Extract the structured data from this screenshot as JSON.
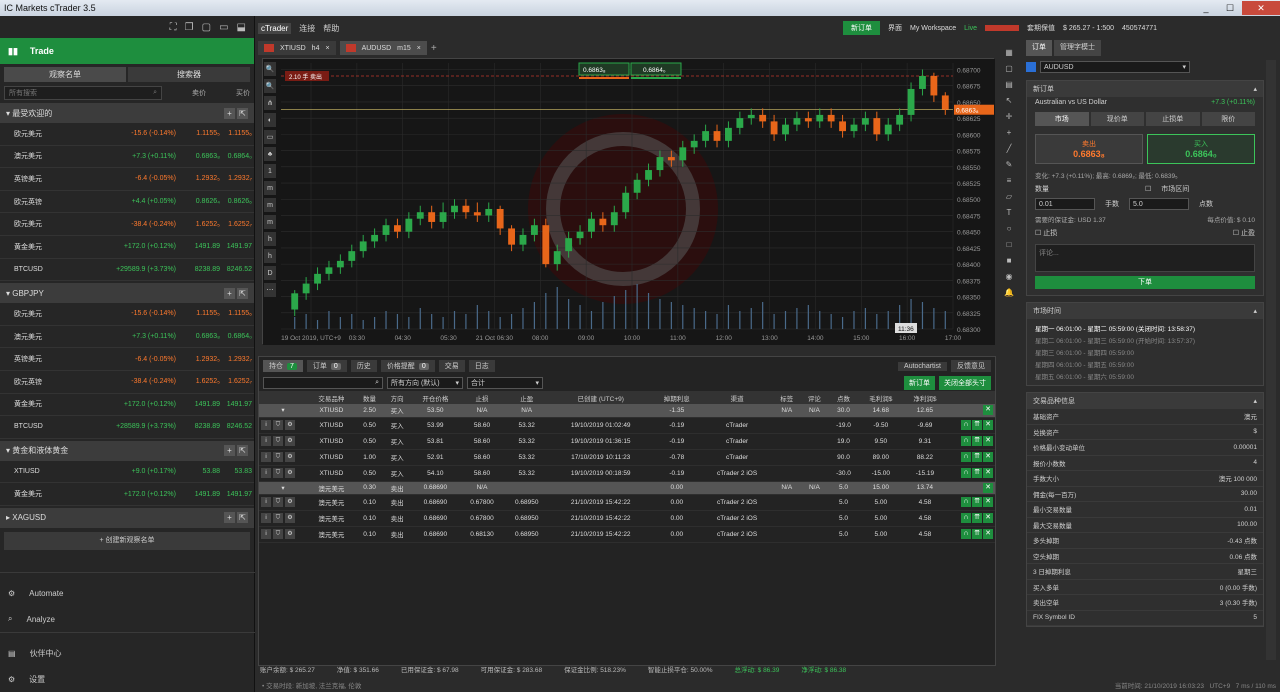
{
  "window": {
    "title": "IC Markets cTrader 3.5",
    "minimize": "_",
    "maximize": "☐",
    "close": "✕"
  },
  "left": {
    "top_icons": [
      "⛶",
      "❐",
      "▢",
      "▭",
      "⬓"
    ],
    "trade_label": "Trade",
    "tabs": [
      "观察名单",
      "搜索器"
    ],
    "search_placeholder": "所有搜索",
    "col_bid": "卖价",
    "col_ask": "买价",
    "groups": [
      {
        "name": "最受欢迎的",
        "collapsed": false,
        "rows": [
          {
            "sym": "欧元美元",
            "chg": "-15.6 (-0.14%)",
            "bid": "1.1155₅",
            "ask": "1.1155₆",
            "up": false
          },
          {
            "sym": "澳元美元",
            "chg": "+7.3 (+0.11%)",
            "bid": "0.6863₈",
            "ask": "0.6864₀",
            "up": true
          },
          {
            "sym": "英镑美元",
            "chg": "-6.4 (-0.05%)",
            "bid": "1.2932₅",
            "ask": "1.2932₇",
            "up": false
          },
          {
            "sym": "欧元英镑",
            "chg": "+4.4 (+0.05%)",
            "bid": "0.8626₄",
            "ask": "0.8626₆",
            "up": true
          },
          {
            "sym": "欧元美元",
            "chg": "-38.4 (-0.24%)",
            "bid": "1.6252₅",
            "ask": "1.6252₇",
            "up": false
          },
          {
            "sym": "黄金美元",
            "chg": "+172.0 (+0.12%)",
            "bid": "1491.89",
            "ask": "1491.97",
            "up": true
          },
          {
            "sym": "BTCUSD",
            "chg": "+29589.9 (+3.73%)",
            "bid": "8238.89",
            "ask": "8246.52",
            "up": true
          }
        ]
      },
      {
        "name": "GBPJPY",
        "collapsed": false,
        "rows": [
          {
            "sym": "欧元美元",
            "chg": "-15.6 (-0.14%)",
            "bid": "1.1155₅",
            "ask": "1.1155₆",
            "up": false
          },
          {
            "sym": "澳元美元",
            "chg": "+7.3 (+0.11%)",
            "bid": "0.6863₈",
            "ask": "0.6864₀",
            "up": true
          },
          {
            "sym": "英镑美元",
            "chg": "-6.4 (-0.05%)",
            "bid": "1.2932₅",
            "ask": "1.2932₇",
            "up": false
          },
          {
            "sym": "欧元英镑",
            "chg": "-38.4 (-0.24%)",
            "bid": "1.6252₅",
            "ask": "1.6252₇",
            "up": false
          },
          {
            "sym": "黄金美元",
            "chg": "+172.0 (+0.12%)",
            "bid": "1491.89",
            "ask": "1491.97",
            "up": true
          },
          {
            "sym": "BTCUSD",
            "chg": "+28589.9 (+3.73%)",
            "bid": "8238.89",
            "ask": "8246.52",
            "up": true
          }
        ]
      },
      {
        "name": "黄金和液体黄金",
        "collapsed": false,
        "rows": [
          {
            "sym": "XTIUSD",
            "chg": "+9.0 (+0.17%)",
            "bid": "53.88",
            "ask": "53.83",
            "up": true
          },
          {
            "sym": "黄金美元",
            "chg": "+172.0 (+0.12%)",
            "bid": "1491.89",
            "ask": "1491.97",
            "up": true
          }
        ]
      },
      {
        "name": "XAGUSD",
        "collapsed": true,
        "rows": []
      }
    ],
    "create_watchlist": "+ 创建新观察名单",
    "nav": [
      "Automate",
      "Analyze",
      "伙伴中心",
      "设置"
    ]
  },
  "menu": {
    "items": [
      "cTrader",
      "连接",
      "帮助"
    ]
  },
  "topright": {
    "new_order": "新订单",
    "interface": "界面",
    "workspace": "My Workspace",
    "live": "Live",
    "account_label": "套期保值",
    "balance": "$ 265.27 - 1:500",
    "account_id": "450574771"
  },
  "chart_tabs": [
    {
      "symbol": "XTIUSD",
      "tf": "h4",
      "active": false
    },
    {
      "symbol": "AUDUSD",
      "tf": "m15",
      "active": true
    }
  ],
  "chart": {
    "sell_price": "0.6863₈",
    "buy_price": "0.6864₀",
    "hline_label": "2.10 手 卖出",
    "current_price": "0.6863₈",
    "price_ticks": [
      "0.68700",
      "0.68675",
      "0.68650",
      "0.68625",
      "0.68600",
      "0.68575",
      "0.68550",
      "0.68525",
      "0.68500",
      "0.68475",
      "0.68450",
      "0.68425",
      "0.68400",
      "0.68375",
      "0.68350",
      "0.68325",
      "0.68300"
    ],
    "time_ticks": [
      "19 Oct 2019, UTC+9",
      "03:30",
      "04:30",
      "05:30",
      "21 Oct 06:30",
      "08:00",
      "09:00",
      "10:00",
      "11:00",
      "12:00",
      "13:00",
      "14:00",
      "15:00",
      "16:00",
      "17:00"
    ],
    "countdown": "11:36",
    "left_tools": [
      "🔍",
      "🔍",
      "⋔",
      "◐",
      "▭",
      "♣",
      "1",
      "m",
      "m",
      "m",
      "h",
      "h",
      "D",
      "⋯"
    ],
    "candles": [
      {
        "o": 0.6833,
        "c": 0.68355,
        "h": 0.6836,
        "l": 0.6832
      },
      {
        "o": 0.68355,
        "c": 0.6837,
        "h": 0.6838,
        "l": 0.68345
      },
      {
        "o": 0.6837,
        "c": 0.68385,
        "h": 0.68395,
        "l": 0.6836
      },
      {
        "o": 0.68385,
        "c": 0.68395,
        "h": 0.68405,
        "l": 0.68375
      },
      {
        "o": 0.68395,
        "c": 0.68405,
        "h": 0.68415,
        "l": 0.68385
      },
      {
        "o": 0.68405,
        "c": 0.6842,
        "h": 0.6843,
        "l": 0.68395
      },
      {
        "o": 0.6842,
        "c": 0.68435,
        "h": 0.68445,
        "l": 0.6841
      },
      {
        "o": 0.68435,
        "c": 0.68445,
        "h": 0.68455,
        "l": 0.68425
      },
      {
        "o": 0.68445,
        "c": 0.6846,
        "h": 0.6847,
        "l": 0.68435
      },
      {
        "o": 0.6846,
        "c": 0.6845,
        "h": 0.6847,
        "l": 0.6844
      },
      {
        "o": 0.6845,
        "c": 0.6847,
        "h": 0.6848,
        "l": 0.6844
      },
      {
        "o": 0.6847,
        "c": 0.6848,
        "h": 0.6849,
        "l": 0.6846
      },
      {
        "o": 0.6848,
        "c": 0.68465,
        "h": 0.6849,
        "l": 0.68455
      },
      {
        "o": 0.68465,
        "c": 0.6848,
        "h": 0.68495,
        "l": 0.68455
      },
      {
        "o": 0.6848,
        "c": 0.6849,
        "h": 0.685,
        "l": 0.6847
      },
      {
        "o": 0.6849,
        "c": 0.6848,
        "h": 0.685,
        "l": 0.6847
      },
      {
        "o": 0.6848,
        "c": 0.68475,
        "h": 0.68495,
        "l": 0.68465
      },
      {
        "o": 0.68475,
        "c": 0.68485,
        "h": 0.68495,
        "l": 0.68465
      },
      {
        "o": 0.68485,
        "c": 0.68455,
        "h": 0.6849,
        "l": 0.68445
      },
      {
        "o": 0.68455,
        "c": 0.6843,
        "h": 0.6846,
        "l": 0.6842
      },
      {
        "o": 0.6843,
        "c": 0.68445,
        "h": 0.68455,
        "l": 0.6842
      },
      {
        "o": 0.68445,
        "c": 0.6846,
        "h": 0.6847,
        "l": 0.68435
      },
      {
        "o": 0.6846,
        "c": 0.684,
        "h": 0.6847,
        "l": 0.68395
      },
      {
        "o": 0.684,
        "c": 0.6842,
        "h": 0.6843,
        "l": 0.6839
      },
      {
        "o": 0.6842,
        "c": 0.6844,
        "h": 0.6845,
        "l": 0.6841
      },
      {
        "o": 0.6844,
        "c": 0.6845,
        "h": 0.6846,
        "l": 0.6843
      },
      {
        "o": 0.6845,
        "c": 0.6847,
        "h": 0.6848,
        "l": 0.6844
      },
      {
        "o": 0.6847,
        "c": 0.6846,
        "h": 0.6848,
        "l": 0.6845
      },
      {
        "o": 0.6846,
        "c": 0.6848,
        "h": 0.6849,
        "l": 0.6845
      },
      {
        "o": 0.6848,
        "c": 0.6851,
        "h": 0.6852,
        "l": 0.6847
      },
      {
        "o": 0.6851,
        "c": 0.6853,
        "h": 0.6854,
        "l": 0.685
      },
      {
        "o": 0.6853,
        "c": 0.68545,
        "h": 0.68555,
        "l": 0.6852
      },
      {
        "o": 0.68545,
        "c": 0.68565,
        "h": 0.68575,
        "l": 0.68535
      },
      {
        "o": 0.68565,
        "c": 0.6856,
        "h": 0.68575,
        "l": 0.6855
      },
      {
        "o": 0.6856,
        "c": 0.6858,
        "h": 0.6859,
        "l": 0.6855
      },
      {
        "o": 0.6858,
        "c": 0.6859,
        "h": 0.686,
        "l": 0.6857
      },
      {
        "o": 0.6859,
        "c": 0.68605,
        "h": 0.68615,
        "l": 0.6858
      },
      {
        "o": 0.68605,
        "c": 0.6859,
        "h": 0.68615,
        "l": 0.6858
      },
      {
        "o": 0.6859,
        "c": 0.6861,
        "h": 0.6862,
        "l": 0.6858
      },
      {
        "o": 0.6861,
        "c": 0.68625,
        "h": 0.68635,
        "l": 0.686
      },
      {
        "o": 0.68625,
        "c": 0.6863,
        "h": 0.6864,
        "l": 0.68615
      },
      {
        "o": 0.6863,
        "c": 0.6862,
        "h": 0.6864,
        "l": 0.6861
      },
      {
        "o": 0.6862,
        "c": 0.686,
        "h": 0.6863,
        "l": 0.6859
      },
      {
        "o": 0.686,
        "c": 0.68615,
        "h": 0.68625,
        "l": 0.6859
      },
      {
        "o": 0.68615,
        "c": 0.68625,
        "h": 0.68635,
        "l": 0.68605
      },
      {
        "o": 0.68625,
        "c": 0.6862,
        "h": 0.68635,
        "l": 0.6861
      },
      {
        "o": 0.6862,
        "c": 0.6863,
        "h": 0.6864,
        "l": 0.6861
      },
      {
        "o": 0.6863,
        "c": 0.6862,
        "h": 0.6864,
        "l": 0.6861
      },
      {
        "o": 0.6862,
        "c": 0.68605,
        "h": 0.6863,
        "l": 0.68595
      },
      {
        "o": 0.68605,
        "c": 0.68615,
        "h": 0.68625,
        "l": 0.68595
      },
      {
        "o": 0.68615,
        "c": 0.68625,
        "h": 0.68635,
        "l": 0.68605
      },
      {
        "o": 0.68625,
        "c": 0.686,
        "h": 0.68635,
        "l": 0.6859
      },
      {
        "o": 0.686,
        "c": 0.68615,
        "h": 0.68625,
        "l": 0.6859
      },
      {
        "o": 0.68615,
        "c": 0.6863,
        "h": 0.6864,
        "l": 0.68605
      },
      {
        "o": 0.6863,
        "c": 0.6867,
        "h": 0.6868,
        "l": 0.6862
      },
      {
        "o": 0.6867,
        "c": 0.6869,
        "h": 0.687,
        "l": 0.6866
      },
      {
        "o": 0.6869,
        "c": 0.6866,
        "h": 0.68695,
        "l": 0.6865
      },
      {
        "o": 0.6866,
        "c": 0.68638,
        "h": 0.68665,
        "l": 0.6863
      }
    ],
    "volumes": [
      4,
      5,
      3,
      6,
      4,
      5,
      3,
      4,
      6,
      5,
      4,
      7,
      5,
      4,
      6,
      5,
      8,
      6,
      4,
      5,
      7,
      9,
      12,
      14,
      10,
      8,
      6,
      9,
      11,
      13,
      15,
      12,
      10,
      9,
      8,
      7,
      6,
      5,
      8,
      6,
      7,
      9,
      5,
      6,
      7,
      8,
      6,
      5,
      4,
      6,
      7,
      5,
      6,
      8,
      10,
      9,
      7,
      6
    ]
  },
  "bottom": {
    "tabs": [
      {
        "label": "持仓",
        "count": "7"
      },
      {
        "label": "订单",
        "count": "0"
      },
      {
        "label": "历史",
        "count": ""
      },
      {
        "label": "价格提醒",
        "count": "0"
      },
      {
        "label": "交易",
        "count": ""
      },
      {
        "label": "日志",
        "count": ""
      }
    ],
    "autochartist": "Autochartist",
    "feedback": "反馈意见",
    "filter_dir": "所有方向 (默认)",
    "filter_group": "合计",
    "new_order_btn": "新订单",
    "close_all_btn": "关闭全部头寸",
    "headers": [
      "交易品种",
      "数量",
      "方向",
      "开仓价格",
      "止损",
      "止盈",
      "已创建 (UTC+9)",
      "掉期利息",
      "渠道",
      "标签",
      "评论",
      "点数",
      "毛利润$",
      "净利润$"
    ],
    "groups": [
      {
        "summary": [
          "XTIUSD",
          "2.50",
          "买入",
          "53.50",
          "N/A",
          "N/A",
          "",
          "-1.35",
          "",
          "N/A",
          "N/A",
          "30.0",
          "14.68",
          "12.65"
        ],
        "rows": [
          [
            "XTIUSD",
            "0.50",
            "买入",
            "53.99",
            "58.60",
            "53.32",
            "19/10/2019 01:02:49",
            "-0.19",
            "cTrader",
            "",
            "",
            "-19.0",
            "-9.50",
            "-9.69"
          ],
          [
            "XTIUSD",
            "0.50",
            "买入",
            "53.81",
            "58.60",
            "53.32",
            "19/10/2019 01:36:15",
            "-0.19",
            "cTrader",
            "",
            "",
            "19.0",
            "9.50",
            "9.31"
          ],
          [
            "XTIUSD",
            "1.00",
            "买入",
            "52.91",
            "58.60",
            "53.32",
            "17/10/2019 10:11:23",
            "-0.78",
            "cTrader",
            "",
            "",
            "90.0",
            "89.00",
            "88.22"
          ],
          [
            "XTIUSD",
            "0.50",
            "买入",
            "54.10",
            "58.60",
            "53.32",
            "19/10/2019 00:18:59",
            "-0.19",
            "cTrader 2 iOS",
            "",
            "",
            "-30.0",
            "-15.00",
            "-15.19"
          ]
        ]
      },
      {
        "summary": [
          "澳元美元",
          "0.30",
          "卖出",
          "0.68690",
          "N/A",
          "",
          "",
          "0.00",
          "",
          "N/A",
          "N/A",
          "5.0",
          "15.00",
          "13.74"
        ],
        "rows": [
          [
            "澳元美元",
            "0.10",
            "卖出",
            "0.68690",
            "0.67800",
            "0.68950",
            "21/10/2019 15:42:22",
            "0.00",
            "cTrader 2 iOS",
            "",
            "",
            "5.0",
            "5.00",
            "4.58"
          ],
          [
            "澳元美元",
            "0.10",
            "卖出",
            "0.68690",
            "0.67800",
            "0.68950",
            "21/10/2019 15:42:22",
            "0.00",
            "cTrader 2 iOS",
            "",
            "",
            "5.0",
            "5.00",
            "4.58"
          ],
          [
            "澳元美元",
            "0.10",
            "卖出",
            "0.68690",
            "0.68130",
            "0.68950",
            "21/10/2019 15:42:22",
            "0.00",
            "cTrader 2 iOS",
            "",
            "",
            "5.0",
            "5.00",
            "4.58"
          ]
        ]
      }
    ],
    "summary_items": [
      "账户余额: $ 265.27",
      "净值: $ 351.66",
      "已用保证金: $ 67.98",
      "可用保证金: $ 283.68",
      "保证金比例: 518.23%",
      "智能止损平仓: 50.00%",
      "总浮动: $ 86.39",
      "净浮动: $ 86.38"
    ]
  },
  "status": {
    "left": "• 交易时段: 新加坡, 法兰克福, 伦敦",
    "right_time": "当前时间: 21/10/2019 16:03:23",
    "tz": "UTC+9",
    "latency": "7 ms / 110 ms"
  },
  "right": {
    "tabs": [
      "订单",
      "管理字模士"
    ],
    "symbol": "AUDUSD",
    "new_order_title": "新订单",
    "instrument": "Australian vs US Dollar",
    "instrument_chg": "+7.3 (+0.11%)",
    "order_types": [
      "市场",
      "现价单",
      "止损单",
      "限价"
    ],
    "sell_label": "卖出",
    "sell_price": "0.6863₈",
    "buy_label": "买入",
    "buy_price": "0.6864₀",
    "change_line": "变化: +7.3 (+0.11%); 最高: 0.6869₂; 最低: 0.6839₅",
    "qty_label": "数量",
    "market_range": "市场区间",
    "qty": "0.01",
    "lots": "手数",
    "pips_val": "5.0",
    "pips": "点数",
    "margin": "需要的保证金: USD 1.37",
    "pip_value": "每点价值: $ 0.10",
    "sl": "止损",
    "tp": "止盈",
    "comment": "评论...",
    "place": "下单",
    "mh_title": "市场时间",
    "market_hours": [
      "星期一  06:01:00 - 星期二  05:59:00  (关闭时间: 13:58:37)",
      "星期二  06:01:00 - 星期三  05:59:00  (开始时间: 13:57:37)",
      "星期三  06:01:00 - 星期四  05:59:00",
      "星期四  06:01:00 - 星期五  05:59:00",
      "星期五  06:01:00 - 星期六  05:59:00"
    ],
    "info_title": "交易品种信息",
    "info": [
      [
        "基础资产",
        "澳元"
      ],
      [
        "兑换资产",
        "$"
      ],
      [
        "价格最小变动单位",
        "0.00001"
      ],
      [
        "报价小数数",
        "4"
      ],
      [
        "手数大小",
        "澳元 100 000"
      ],
      [
        "佣金(每一百万)",
        "30.00"
      ],
      [
        "最小交易数量",
        "0.01"
      ],
      [
        "最大交易数量",
        "100.00"
      ],
      [
        "多头掉期",
        "-0.43 点数"
      ],
      [
        "空头掉期",
        "0.06 点数"
      ],
      [
        "3 日掉期利息",
        "星期三"
      ],
      [
        "买入多单",
        "0 (0.00 手数)"
      ],
      [
        "卖出空单",
        "3 (0.30 手数)"
      ],
      [
        "FIX Symbol ID",
        "5"
      ]
    ]
  },
  "colors": {
    "green": "#1e8e3e",
    "up": "#3cc45a",
    "down": "#ff7a2e"
  }
}
